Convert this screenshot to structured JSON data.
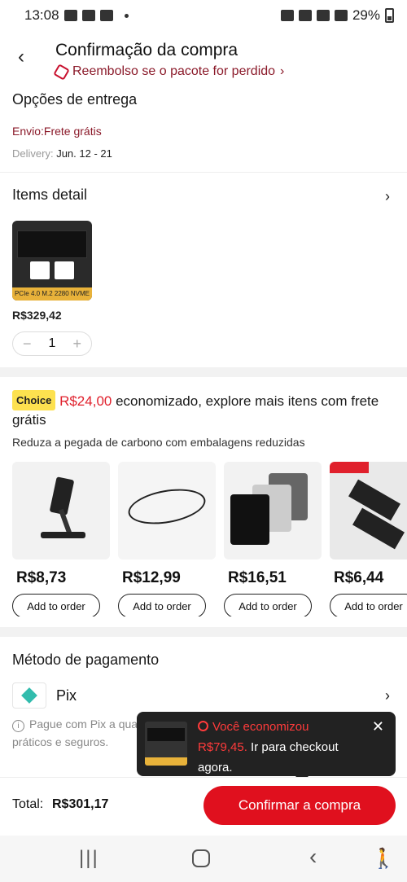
{
  "status_bar": {
    "time": "13:08",
    "battery": "29%"
  },
  "header": {
    "title": "Confirmação da compra",
    "refund": "Reembolso se o pacote for perdido"
  },
  "delivery": {
    "title": "Opções de entrega",
    "shipping": "Envio:Frete grátis",
    "delivery_label": "Delivery:",
    "delivery_dates": "Jun. 12 - 21"
  },
  "items_detail": {
    "title": "Items detail",
    "product": {
      "band_text": "PCIe 4.0 M.2 2280 NVME",
      "price": "R$329,42",
      "quantity": "1"
    }
  },
  "choice": {
    "badge": "Choice",
    "saved": "R$24,00",
    "headline_rest": " economizado, explore mais itens com frete grátis",
    "carbon": "Reduza a pegada de carbono com embalagens reduzidas",
    "recommendations": [
      {
        "price": "R$8,73",
        "button": "Add to order"
      },
      {
        "price": "R$12,99",
        "button": "Add to order"
      },
      {
        "price": "R$16,51",
        "button": "Add to order"
      },
      {
        "price": "R$6,44",
        "button": "Add to order"
      }
    ]
  },
  "payment": {
    "title": "Método de pagamento",
    "method": "Pix",
    "info": "Pague com Pix a qualquer hora. Os pagamentos são simples, práticos e seguros."
  },
  "toast": {
    "line1": "Você economizou",
    "amount": "R$79,45.",
    "rest": " Ir para checkout agora."
  },
  "bottom": {
    "total_label": "Total:",
    "total_value": "R$301,17",
    "confirm": "Confirmar a compra"
  },
  "colors": {
    "accent": "#e0101e",
    "choice_badge": "#fde14f",
    "refund_text": "#8b1a2a",
    "pix": "#32bcad"
  }
}
